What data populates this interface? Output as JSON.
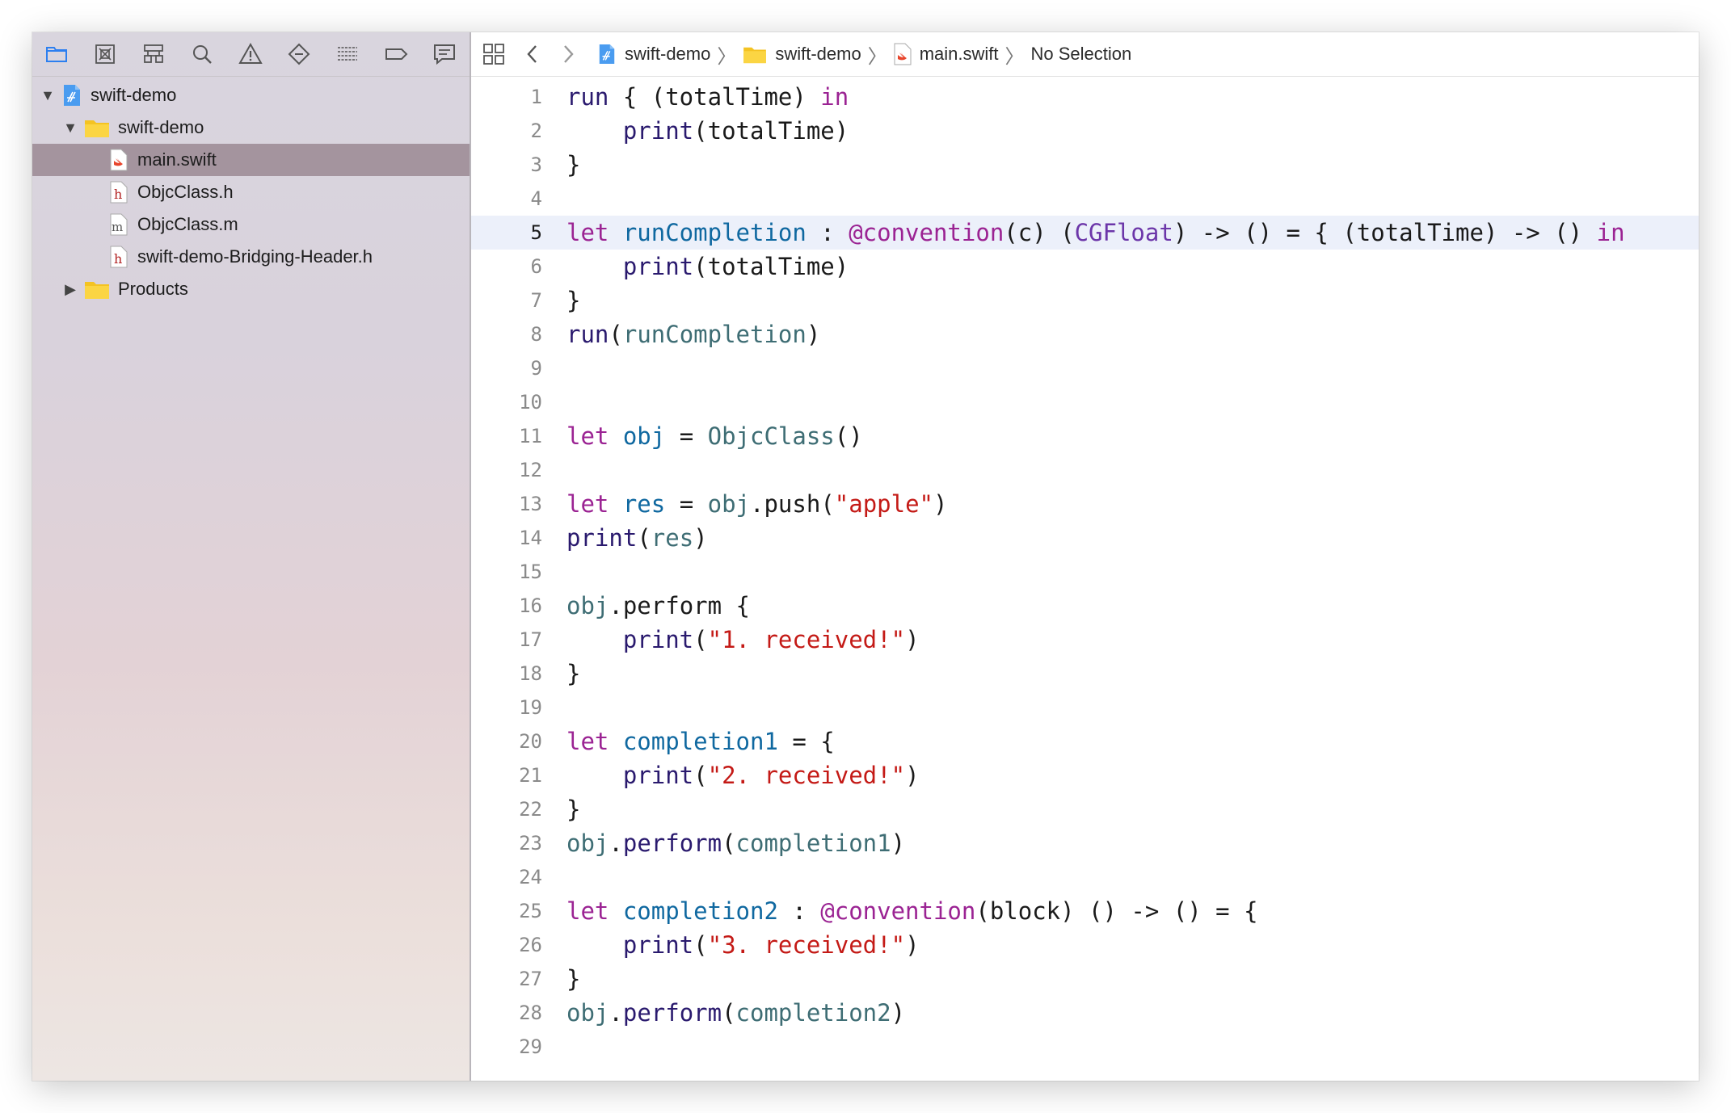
{
  "colors": {
    "keyword": "#9b2393",
    "function": "#2a1a6e",
    "identifier": "#3e6d74",
    "type": "#6c36a9",
    "string": "#c41a16",
    "declaration": "#0f68a0",
    "selection": "#a4949e",
    "current_line": "#ecf0fa"
  },
  "navigator": {
    "toolbar_icons": [
      "folder-icon",
      "source-control-icon",
      "hierarchy-icon",
      "search-icon",
      "warning-icon",
      "test-diamond-icon",
      "debug-lines-icon",
      "breakpoint-icon",
      "report-icon"
    ],
    "items": [
      {
        "label": "swift-demo",
        "type": "project",
        "level": 0,
        "expanded": true
      },
      {
        "label": "swift-demo",
        "type": "folder",
        "level": 1,
        "expanded": true
      },
      {
        "label": "main.swift",
        "type": "swift",
        "level": 2,
        "selected": true
      },
      {
        "label": "ObjcClass.h",
        "type": "h",
        "level": 2
      },
      {
        "label": "ObjcClass.m",
        "type": "m",
        "level": 2
      },
      {
        "label": "swift-demo-Bridging-Header.h",
        "type": "h",
        "level": 2
      },
      {
        "label": "Products",
        "type": "folder",
        "level": 1,
        "expanded": false
      }
    ]
  },
  "jumpbar": {
    "project": "swift-demo",
    "folder": "swift-demo",
    "file": "main.swift",
    "selection": "No Selection"
  },
  "editor": {
    "current_line": 5,
    "lines": [
      [
        [
          "run ",
          "fn"
        ],
        [
          "{ (totalTime) ",
          ""
        ],
        [
          "in",
          "kw"
        ]
      ],
      [
        [
          "    ",
          ""
        ],
        [
          "print",
          "fn"
        ],
        [
          "(totalTime)",
          ""
        ]
      ],
      [
        [
          "}",
          ""
        ]
      ],
      [],
      [
        [
          "let ",
          "kw"
        ],
        [
          "runCompletion",
          "dc"
        ],
        [
          " : ",
          ""
        ],
        [
          "@convention",
          "kw"
        ],
        [
          "(c) (",
          ""
        ],
        [
          "CGFloat",
          "ty"
        ],
        [
          ") -> () = { (totalTime) -> () ",
          ""
        ],
        [
          "in",
          "kw"
        ]
      ],
      [
        [
          "    ",
          ""
        ],
        [
          "print",
          "fn"
        ],
        [
          "(totalTime)",
          ""
        ]
      ],
      [
        [
          "}",
          ""
        ]
      ],
      [
        [
          "run",
          "fn"
        ],
        [
          "(",
          ""
        ],
        [
          "runCompletion",
          "id"
        ],
        [
          ")",
          ""
        ]
      ],
      [],
      [],
      [
        [
          "let ",
          "kw"
        ],
        [
          "obj",
          "dc"
        ],
        [
          " = ",
          ""
        ],
        [
          "ObjcClass",
          "id"
        ],
        [
          "()",
          ""
        ]
      ],
      [],
      [
        [
          "let ",
          "kw"
        ],
        [
          "res",
          "dc"
        ],
        [
          " = ",
          ""
        ],
        [
          "obj",
          "id"
        ],
        [
          ".push(",
          ""
        ],
        [
          "\"apple\"",
          "st"
        ],
        [
          ")",
          ""
        ]
      ],
      [
        [
          "print",
          "fn"
        ],
        [
          "(",
          ""
        ],
        [
          "res",
          "id"
        ],
        [
          ")",
          ""
        ]
      ],
      [],
      [
        [
          "obj",
          "id"
        ],
        [
          ".perform {",
          ""
        ]
      ],
      [
        [
          "    ",
          ""
        ],
        [
          "print",
          "fn"
        ],
        [
          "(",
          ""
        ],
        [
          "\"1. received!\"",
          "st"
        ],
        [
          ")",
          ""
        ]
      ],
      [
        [
          "}",
          ""
        ]
      ],
      [],
      [
        [
          "let ",
          "kw"
        ],
        [
          "completion1",
          "dc"
        ],
        [
          " = {",
          ""
        ]
      ],
      [
        [
          "    ",
          ""
        ],
        [
          "print",
          "fn"
        ],
        [
          "(",
          ""
        ],
        [
          "\"2. received!\"",
          "st"
        ],
        [
          ")",
          ""
        ]
      ],
      [
        [
          "}",
          ""
        ]
      ],
      [
        [
          "obj",
          "id"
        ],
        [
          ".",
          ""
        ],
        [
          "perform",
          "fn"
        ],
        [
          "(",
          ""
        ],
        [
          "completion1",
          "id"
        ],
        [
          ")",
          ""
        ]
      ],
      [],
      [
        [
          "let ",
          "kw"
        ],
        [
          "completion2",
          "dc"
        ],
        [
          " : ",
          ""
        ],
        [
          "@convention",
          "kw"
        ],
        [
          "(block) () -> () = {",
          ""
        ]
      ],
      [
        [
          "    ",
          ""
        ],
        [
          "print",
          "fn"
        ],
        [
          "(",
          ""
        ],
        [
          "\"3. received!\"",
          "st"
        ],
        [
          ")",
          ""
        ]
      ],
      [
        [
          "}",
          ""
        ]
      ],
      [
        [
          "obj",
          "id"
        ],
        [
          ".",
          ""
        ],
        [
          "perform",
          "fn"
        ],
        [
          "(",
          ""
        ],
        [
          "completion2",
          "id"
        ],
        [
          ")",
          ""
        ]
      ],
      []
    ]
  }
}
